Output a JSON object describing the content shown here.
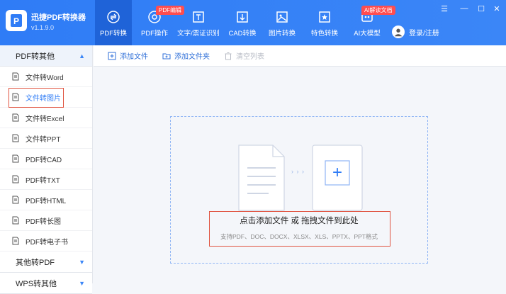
{
  "app": {
    "name": "迅捷PDF转换器",
    "version": "v1.1.9.0"
  },
  "nav": [
    {
      "label": "PDF转换",
      "icon": "convert-icon",
      "active": true
    },
    {
      "label": "PDF操作",
      "icon": "pdf-tool-icon",
      "badge": "PDF编辑"
    },
    {
      "label": "文字/票证识别",
      "icon": "ocr-icon"
    },
    {
      "label": "CAD转换",
      "icon": "cad-icon"
    },
    {
      "label": "图片转换",
      "icon": "image-icon"
    },
    {
      "label": "特色转换",
      "icon": "star-icon"
    },
    {
      "label": "AI大模型",
      "icon": "ai-icon",
      "badge": "AI解读文档"
    }
  ],
  "login": {
    "label": "登录/注册"
  },
  "window": {
    "menu": "☰",
    "minimize": "—",
    "maximize": "☐",
    "close": "✕"
  },
  "sidebar": {
    "section1": "PDF转其他",
    "items": [
      "文件转Word",
      "文件转图片",
      "文件转Excel",
      "文件转PPT",
      "PDF转CAD",
      "PDF转TXT",
      "PDF转HTML",
      "PDF转长图",
      "PDF转电子书"
    ],
    "active_index": 1,
    "section2": "其他转PDF",
    "section3": "WPS转其他"
  },
  "toolbar": {
    "add_file": "添加文件",
    "add_folder": "添加文件夹",
    "clear_list": "清空列表"
  },
  "dropzone": {
    "main": "点击添加文件 或 拖拽文件到此处",
    "sub": "支持PDF、DOC、DOCX、XLSX、XLS、PPTX、PPT格式",
    "arrows": "› › ›",
    "plus": "+"
  },
  "colors": {
    "accent": "#2f7cf6",
    "highlight": "#e0533f",
    "badge": "#ff4d4f"
  }
}
